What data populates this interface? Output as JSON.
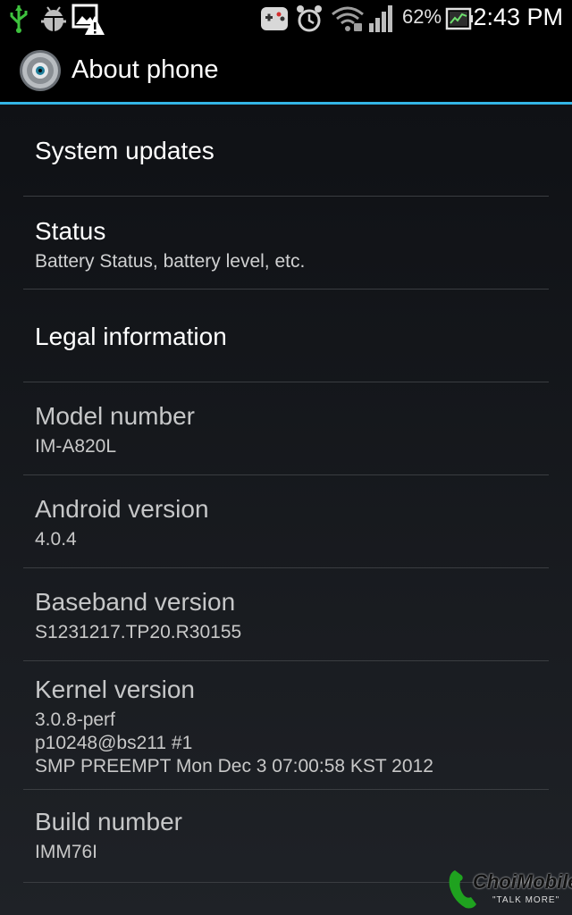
{
  "status_bar": {
    "battery_percent": "62%",
    "time": "2:43 PM",
    "icons": [
      "usb-icon",
      "debug-icon",
      "image-warning-icon",
      "game-icon",
      "alarm-icon",
      "wifi-icon",
      "signal-icon",
      "battery-icon"
    ]
  },
  "action_bar": {
    "title": "About phone",
    "icon": "settings-gear-icon"
  },
  "items": [
    {
      "title": "System updates"
    },
    {
      "title": "Status",
      "summary": "Battery Status, battery level, etc."
    },
    {
      "title": "Legal information"
    },
    {
      "title": "Model number",
      "summary": "IM-A820L"
    },
    {
      "title": "Android version",
      "summary": "4.0.4"
    },
    {
      "title": "Baseband version",
      "summary": "S1231217.TP20.R30155"
    },
    {
      "title": "Kernel version",
      "summary_lines": [
        "3.0.8-perf",
        "p10248@bs211 #1",
        "SMP PREEMPT Mon Dec 3 07:00:58 KST 2012"
      ]
    },
    {
      "title": "Build number",
      "summary": "IMM76I"
    }
  ],
  "watermark": {
    "brand": "ChoiMobile",
    "tagline": "\"TALK MORE\""
  },
  "colors": {
    "accent": "#33b5e5",
    "background": "#000000",
    "usb": "#3ec23e"
  }
}
